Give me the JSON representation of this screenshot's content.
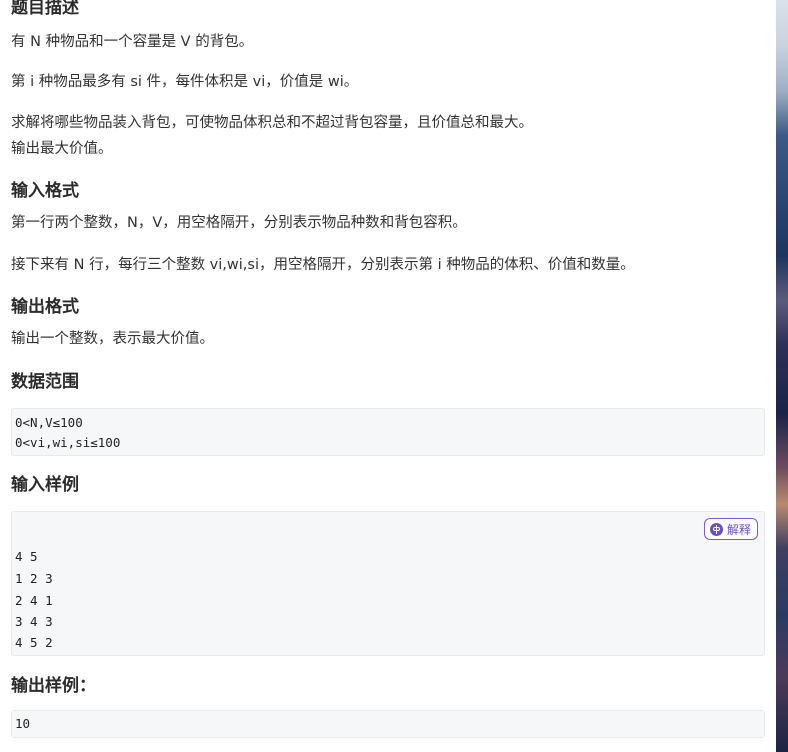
{
  "description": {
    "heading": "题目描述",
    "line1": "有 N 种物品和一个容量是 V 的背包。",
    "line2": "第 i 种物品最多有 si 件，每件体积是 vi，价值是 wi。",
    "line3": "求解将哪些物品装入背包，可使物品体积总和不超过背包容量，且价值总和最大。",
    "line4": "输出最大价值。"
  },
  "input_format": {
    "heading": "输入格式",
    "line1": "第一行两个整数，N，V，用空格隔开，分别表示物品种数和背包容积。",
    "line2": "接下来有 N 行，每行三个整数 vi,wi,si，用空格隔开，分别表示第 i 种物品的体积、价值和数量。"
  },
  "output_format": {
    "heading": "输出格式",
    "line1": "输出一个整数，表示最大价值。"
  },
  "data_range": {
    "heading": "数据范围",
    "lines": [
      "0<N,V≤100",
      "0<vi,wi,si≤100"
    ]
  },
  "input_sample": {
    "heading": "输入样例",
    "explain_label": "解释",
    "lines": [
      "4 5",
      "1 2 3",
      "2 4 1",
      "3 4 3",
      "4 5 2"
    ]
  },
  "output_sample": {
    "heading": "输出样例：",
    "lines": [
      "10"
    ]
  }
}
